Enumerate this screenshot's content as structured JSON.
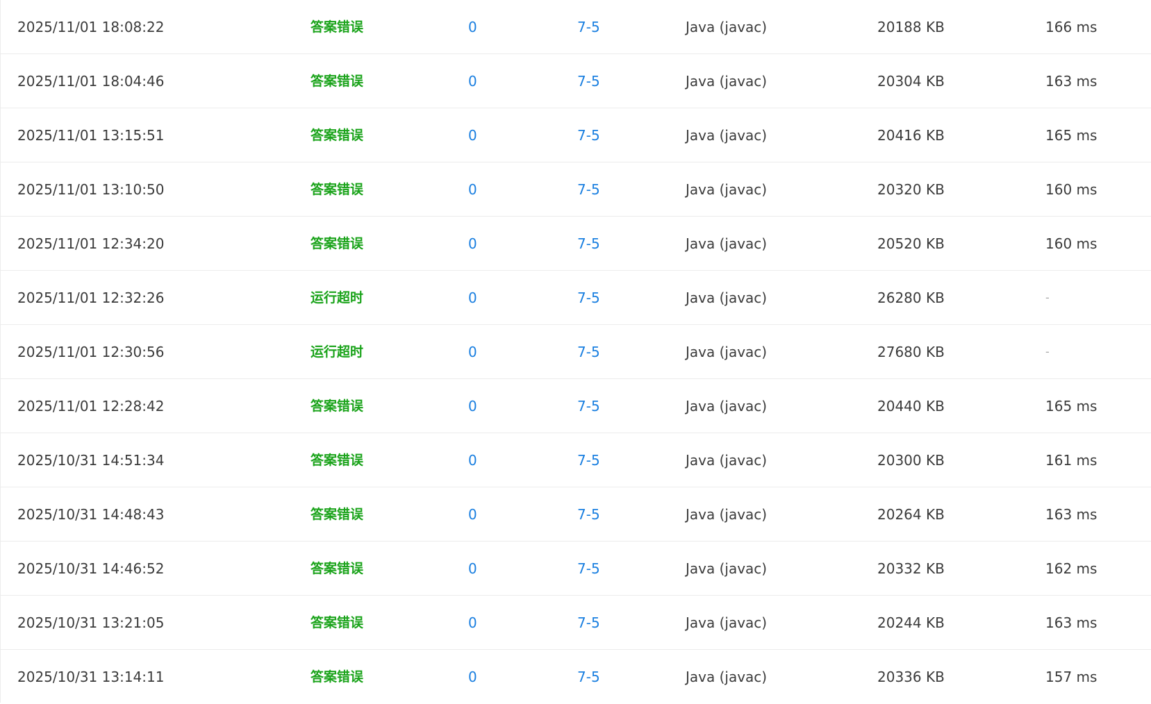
{
  "colors": {
    "status_ok_green": "#1aa31a",
    "link_blue": "#1a7fe0",
    "text": "#3a3a3a",
    "row_border": "#ececec"
  },
  "rows": [
    {
      "time": "2025/11/01 18:08:22",
      "status": "答案错误",
      "score": "0",
      "problem": "7-5",
      "language": "Java (javac)",
      "memory": "20188 KB",
      "runtime": "166 ms"
    },
    {
      "time": "2025/11/01 18:04:46",
      "status": "答案错误",
      "score": "0",
      "problem": "7-5",
      "language": "Java (javac)",
      "memory": "20304 KB",
      "runtime": "163 ms"
    },
    {
      "time": "2025/11/01 13:15:51",
      "status": "答案错误",
      "score": "0",
      "problem": "7-5",
      "language": "Java (javac)",
      "memory": "20416 KB",
      "runtime": "165 ms"
    },
    {
      "time": "2025/11/01 13:10:50",
      "status": "答案错误",
      "score": "0",
      "problem": "7-5",
      "language": "Java (javac)",
      "memory": "20320 KB",
      "runtime": "160 ms"
    },
    {
      "time": "2025/11/01 12:34:20",
      "status": "答案错误",
      "score": "0",
      "problem": "7-5",
      "language": "Java (javac)",
      "memory": "20520 KB",
      "runtime": "160 ms"
    },
    {
      "time": "2025/11/01 12:32:26",
      "status": "运行超时",
      "score": "0",
      "problem": "7-5",
      "language": "Java (javac)",
      "memory": "26280 KB",
      "runtime": "-"
    },
    {
      "time": "2025/11/01 12:30:56",
      "status": "运行超时",
      "score": "0",
      "problem": "7-5",
      "language": "Java (javac)",
      "memory": "27680 KB",
      "runtime": "-"
    },
    {
      "time": "2025/11/01 12:28:42",
      "status": "答案错误",
      "score": "0",
      "problem": "7-5",
      "language": "Java (javac)",
      "memory": "20440 KB",
      "runtime": "165 ms"
    },
    {
      "time": "2025/10/31 14:51:34",
      "status": "答案错误",
      "score": "0",
      "problem": "7-5",
      "language": "Java (javac)",
      "memory": "20300 KB",
      "runtime": "161 ms"
    },
    {
      "time": "2025/10/31 14:48:43",
      "status": "答案错误",
      "score": "0",
      "problem": "7-5",
      "language": "Java (javac)",
      "memory": "20264 KB",
      "runtime": "163 ms"
    },
    {
      "time": "2025/10/31 14:46:52",
      "status": "答案错误",
      "score": "0",
      "problem": "7-5",
      "language": "Java (javac)",
      "memory": "20332 KB",
      "runtime": "162 ms"
    },
    {
      "time": "2025/10/31 13:21:05",
      "status": "答案错误",
      "score": "0",
      "problem": "7-5",
      "language": "Java (javac)",
      "memory": "20244 KB",
      "runtime": "163 ms"
    },
    {
      "time": "2025/10/31 13:14:11",
      "status": "答案错误",
      "score": "0",
      "problem": "7-5",
      "language": "Java (javac)",
      "memory": "20336 KB",
      "runtime": "157 ms"
    }
  ]
}
